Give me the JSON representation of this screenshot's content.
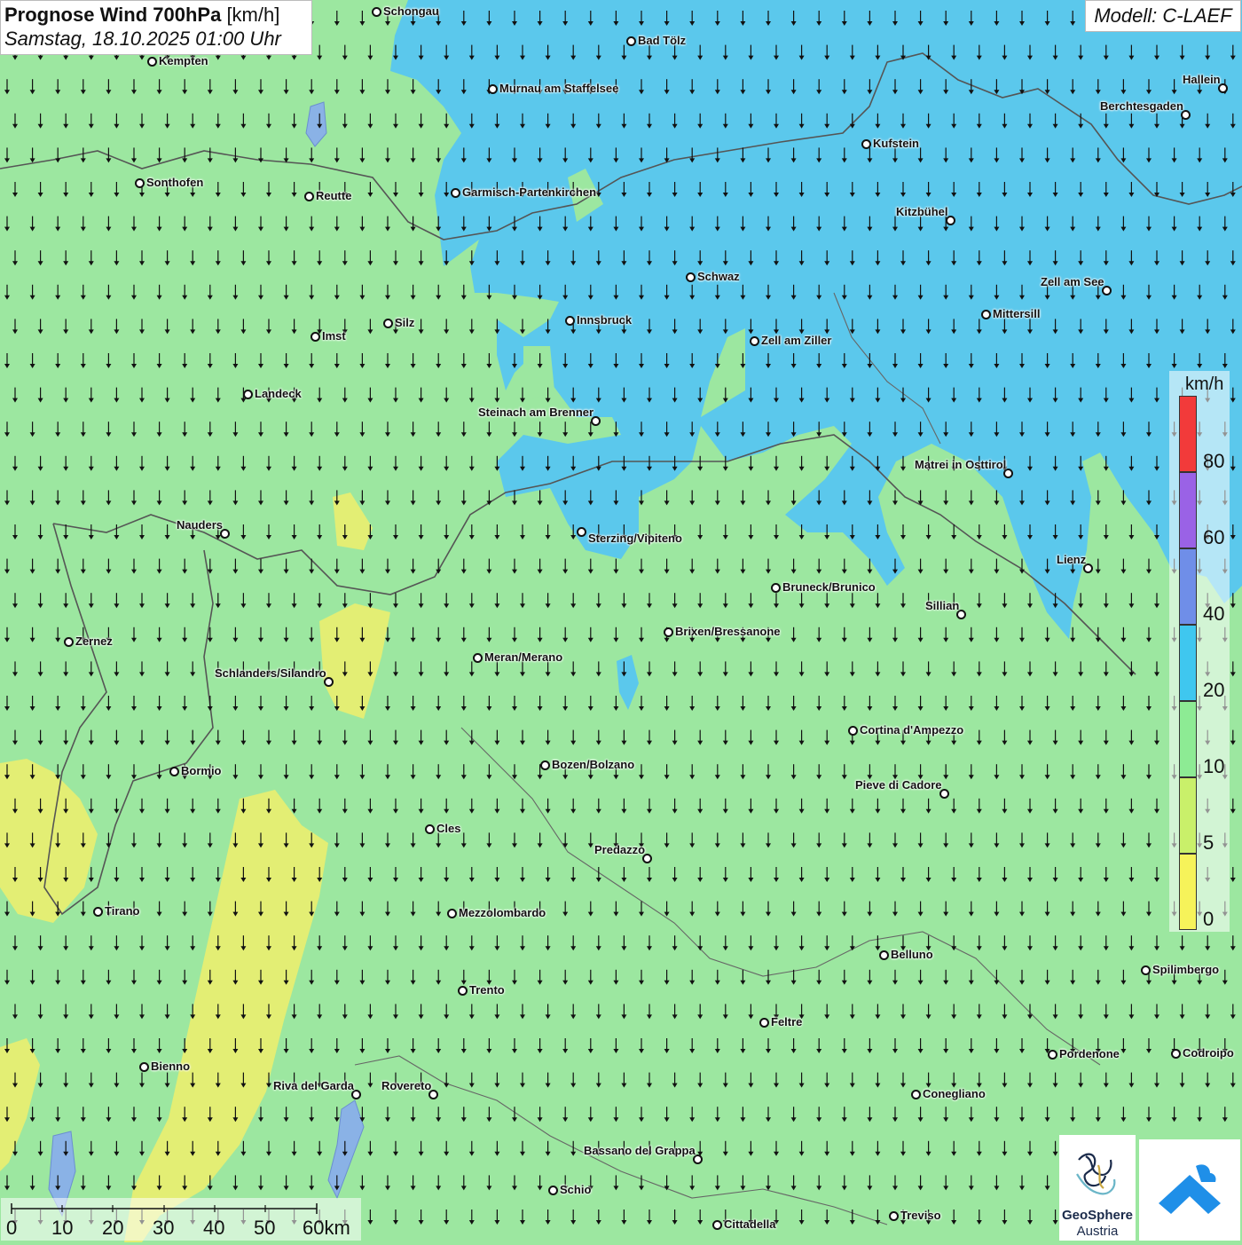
{
  "title": {
    "main": "Prognose Wind 700hPa",
    "unit": "[km/h]",
    "datetime": "Samstag, 18.10.2025 01:00 Uhr"
  },
  "model_label": "Modell: C-LAEF",
  "legend": {
    "unit": "km/h",
    "ticks": [
      "0",
      "5",
      "10",
      "20",
      "40",
      "60",
      "80"
    ],
    "colors": {
      "0-5": "#f6f35a",
      "5-10": "#c9f06a",
      "10-20": "#8deb94",
      "20-40": "#3fc7ef",
      "40-60": "#6f8ee8",
      "60-80": "#9a62e6",
      "80+": "#f23a3a"
    }
  },
  "map_colors": {
    "low_wind": "#9ce7a0",
    "mid_wind": "#5bc8ec",
    "very_low_wind": "#e3ee74",
    "border": "#555555",
    "arrow": "#111111"
  },
  "wind_direction": "south",
  "cities": [
    {
      "name": "Schongau"
    },
    {
      "name": "Bad Tölz"
    },
    {
      "name": "Kempten"
    },
    {
      "name": "Murnau am Staffelsee"
    },
    {
      "name": "Hallein"
    },
    {
      "name": "Berchtesgaden"
    },
    {
      "name": "Kufstein"
    },
    {
      "name": "Sonthofen"
    },
    {
      "name": "Reutte"
    },
    {
      "name": "Garmisch-Partenkirchen"
    },
    {
      "name": "Kitzbühel"
    },
    {
      "name": "Schwaz"
    },
    {
      "name": "Zell am See"
    },
    {
      "name": "Mittersill"
    },
    {
      "name": "Innsbruck"
    },
    {
      "name": "Silz"
    },
    {
      "name": "Imst"
    },
    {
      "name": "Zell am Ziller"
    },
    {
      "name": "Landeck"
    },
    {
      "name": "Steinach am Brenner"
    },
    {
      "name": "Matrei in Osttirol"
    },
    {
      "name": "Nauders"
    },
    {
      "name": "Sterzing/Vipiteno"
    },
    {
      "name": "Lienz"
    },
    {
      "name": "Bruneck/Brunico"
    },
    {
      "name": "Sillian"
    },
    {
      "name": "Brixen/Bressanone"
    },
    {
      "name": "Zernez"
    },
    {
      "name": "Meran/Merano"
    },
    {
      "name": "Schlanders/Silandro"
    },
    {
      "name": "Cortina d'Ampezzo"
    },
    {
      "name": "Bozen/Bolzano"
    },
    {
      "name": "Bormio"
    },
    {
      "name": "Pieve di Cadore"
    },
    {
      "name": "Cles"
    },
    {
      "name": "Predazzo"
    },
    {
      "name": "Tirano"
    },
    {
      "name": "Mezzolombardo"
    },
    {
      "name": "Belluno"
    },
    {
      "name": "Spilimbergo"
    },
    {
      "name": "Trento"
    },
    {
      "name": "Feltre"
    },
    {
      "name": "Pordenone"
    },
    {
      "name": "Codroipo"
    },
    {
      "name": "Bienno"
    },
    {
      "name": "Riva del Garda"
    },
    {
      "name": "Rovereto"
    },
    {
      "name": "Conegliano"
    },
    {
      "name": "Bassano del Grappa"
    },
    {
      "name": "Schio"
    },
    {
      "name": "Treviso"
    },
    {
      "name": "Cittadella"
    }
  ],
  "scalebar": {
    "labels": [
      "0",
      "10",
      "20",
      "30",
      "40",
      "50",
      "60km"
    ]
  },
  "logos": {
    "geosphere_name": "GeoSphere",
    "geosphere_sub": "Austria"
  }
}
